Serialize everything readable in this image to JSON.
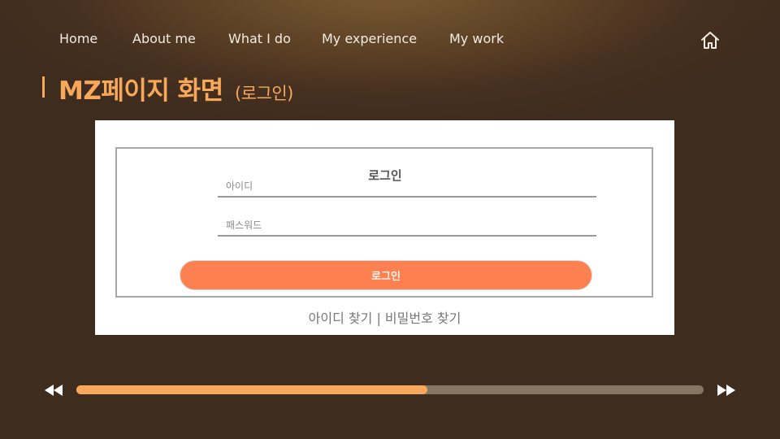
{
  "nav": {
    "items": [
      {
        "label": "Home"
      },
      {
        "label": "About me"
      },
      {
        "label": "What I do"
      },
      {
        "label": "My experience"
      },
      {
        "label": "My work"
      }
    ],
    "home_icon": "home-icon"
  },
  "page": {
    "title": "MZ페이지 화면",
    "subtitle": "(로그인)",
    "accent_color": "#f7a85a"
  },
  "login_form": {
    "legend": "로그인",
    "id_placeholder": "아이디",
    "password_placeholder": "패스워드",
    "submit_label": "로그인",
    "find_id": "아이디 찾기",
    "separator": "|",
    "find_password": "비밀번호 찾기",
    "button_color": "#fd8050"
  },
  "player": {
    "rewind_icon": "rewind-icon",
    "forward_icon": "fast-forward-icon",
    "progress_fraction": 0.56
  }
}
